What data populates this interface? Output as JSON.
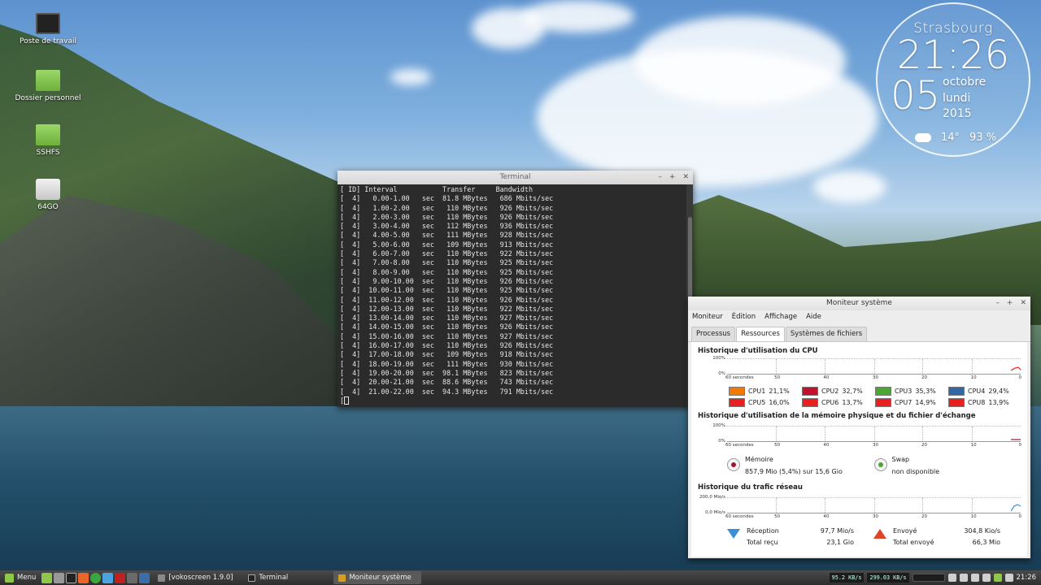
{
  "desktop": {
    "icons": [
      {
        "label": "Poste de travail",
        "icon": "computer-icon"
      },
      {
        "label": "Dossier personnel",
        "icon": "home-folder-icon"
      },
      {
        "label": "SSHFS",
        "icon": "folder-icon"
      },
      {
        "label": "64GO",
        "icon": "usb-drive-icon"
      }
    ]
  },
  "clock": {
    "city": "Strasbourg",
    "time": "21:26",
    "day": "05",
    "month": "octobre",
    "weekday": "lundi",
    "year": "2015",
    "temperature": "14°",
    "humidity": "93 %",
    "weather_icon": "cloud-rain-icon"
  },
  "terminal": {
    "title": "Terminal",
    "header": "[ ID] Interval           Transfer     Bandwidth",
    "lines": [
      "[  4]   0.00-1.00   sec  81.8 MBytes   686 Mbits/sec",
      "[  4]   1.00-2.00   sec   110 MBytes   926 Mbits/sec",
      "[  4]   2.00-3.00   sec   110 MBytes   926 Mbits/sec",
      "[  4]   3.00-4.00   sec   112 MBytes   936 Mbits/sec",
      "[  4]   4.00-5.00   sec   111 MBytes   928 Mbits/sec",
      "[  4]   5.00-6.00   sec   109 MBytes   913 Mbits/sec",
      "[  4]   6.00-7.00   sec   110 MBytes   922 Mbits/sec",
      "[  4]   7.00-8.00   sec   110 MBytes   925 Mbits/sec",
      "[  4]   8.00-9.00   sec   110 MBytes   925 Mbits/sec",
      "[  4]   9.00-10.00  sec   110 MBytes   926 Mbits/sec",
      "[  4]  10.00-11.00  sec   110 MBytes   925 Mbits/sec",
      "[  4]  11.00-12.00  sec   110 MBytes   926 Mbits/sec",
      "[  4]  12.00-13.00  sec   110 MBytes   922 Mbits/sec",
      "[  4]  13.00-14.00  sec   110 MBytes   927 Mbits/sec",
      "[  4]  14.00-15.00  sec   110 MBytes   926 Mbits/sec",
      "[  4]  15.00-16.00  sec   110 MBytes   927 Mbits/sec",
      "[  4]  16.00-17.00  sec   110 MBytes   926 Mbits/sec",
      "[  4]  17.00-18.00  sec   109 MBytes   918 Mbits/sec",
      "[  4]  18.00-19.00  sec   111 MBytes   930 Mbits/sec",
      "[  4]  19.00-20.00  sec  98.1 MBytes   823 Mbits/sec",
      "[  4]  20.00-21.00  sec  88.6 MBytes   743 Mbits/sec",
      "[  4]  21.00-22.00  sec  94.3 MBytes   791 Mbits/sec"
    ],
    "prompt": "["
  },
  "sysmon": {
    "title": "Moniteur système",
    "menu": [
      "Moniteur",
      "Édition",
      "Affichage",
      "Aide"
    ],
    "tabs": [
      "Processus",
      "Ressources",
      "Systèmes de fichiers"
    ],
    "active_tab": "Ressources",
    "cpu_title": "Historique d'utilisation du CPU",
    "mem_title": "Historique d'utilisation de la mémoire physique et du fichier d'échange",
    "net_title": "Historique du trafic réseau",
    "x_labels": [
      "60 secondes",
      "50",
      "40",
      "30",
      "20",
      "10",
      "0"
    ],
    "cpu_y": [
      "100%",
      "0%"
    ],
    "mem_y": [
      "100%",
      "0%"
    ],
    "net_y": [
      "200,0 Mio/s",
      "0,0 Mio/s"
    ],
    "cpus": [
      {
        "label": "CPU1",
        "value": "21,1%",
        "color": "#f57900"
      },
      {
        "label": "CPU2",
        "value": "32,7%",
        "color": "#c4102f"
      },
      {
        "label": "CPU3",
        "value": "35,3%",
        "color": "#4ca632"
      },
      {
        "label": "CPU4",
        "value": "29,4%",
        "color": "#3465a4"
      },
      {
        "label": "CPU5",
        "value": "16,0%",
        "color": "#e82020"
      },
      {
        "label": "CPU6",
        "value": "13,7%",
        "color": "#e82020"
      },
      {
        "label": "CPU7",
        "value": "14,9%",
        "color": "#e82020"
      },
      {
        "label": "CPU8",
        "value": "13,9%",
        "color": "#e82020"
      }
    ],
    "memory": {
      "label": "Mémoire",
      "value": "857,9 Mio (5,4%) sur 15,6 Gio",
      "color": "#a01830"
    },
    "swap": {
      "label": "Swap",
      "value": "non disponible",
      "color": "#4ca632"
    },
    "network": {
      "rx_label": "Réception",
      "rx_value": "97,7 Mio/s",
      "rx_total_label": "Total reçu",
      "rx_total": "23,1 Gio",
      "tx_label": "Envoyé",
      "tx_value": "304,8 Kio/s",
      "tx_total_label": "Total envoyé",
      "tx_total": "66,3 Mio"
    }
  },
  "taskbar": {
    "menu_label": "Menu",
    "tasks": [
      {
        "label": "[vokoscreen 1.9.0]",
        "active": false
      },
      {
        "label": "Terminal",
        "active": false
      },
      {
        "label": "Moniteur système",
        "active": true
      }
    ],
    "net_down": "95.2 KB/s",
    "net_up": "299.03 KB/s",
    "time": "21:26"
  }
}
